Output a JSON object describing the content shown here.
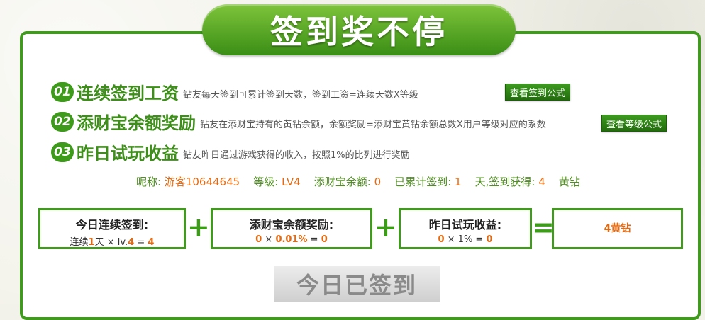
{
  "header": {
    "title": "签到奖不停"
  },
  "rules": [
    {
      "num": "01",
      "title": "连续签到工资",
      "desc": "钻友每天签到可累计签到天数，签到工资=连续天数X等级"
    },
    {
      "num": "02",
      "title": "添财宝余额奖励",
      "desc": "钻友在添财宝持有的黄钻余额，余额奖励=添财宝黄钻余额总数X用户等级对应的系数"
    },
    {
      "num": "03",
      "title": "昨日试玩收益",
      "desc": "钻友昨日通过游戏获得的收入，按照1%的比列进行奖励"
    }
  ],
  "buttons": {
    "formula_sign": "查看签到公式",
    "formula_level": "查看等级公式",
    "signed": "今日已签到"
  },
  "status": {
    "nick_label": "昵称:",
    "nick": "游客10644645",
    "level_label": "等级:",
    "level": "LV4",
    "balance_label": "添财宝余额:",
    "balance": "0",
    "days_label": "已累计签到:",
    "days": "1",
    "gain_label": "天,签到获得:",
    "gain": "4",
    "unit": "黄钻"
  },
  "calc": {
    "box1": {
      "title": "今日连续签到:",
      "pre": "连续",
      "days": "1",
      "mid": "天 × lv.",
      "lv": "4",
      "eq": " = ",
      "result": "4"
    },
    "box2": {
      "title": "添财宝余额奖励:",
      "a": "0",
      "x": " × ",
      "b": "0.01%",
      "eq": " = ",
      "result": "0"
    },
    "box3": {
      "title": "昨日试玩收益:",
      "a": "0",
      "x": " × 1% = ",
      "result": "0"
    },
    "total": "4黄钻",
    "plus": "+",
    "equals": "="
  }
}
